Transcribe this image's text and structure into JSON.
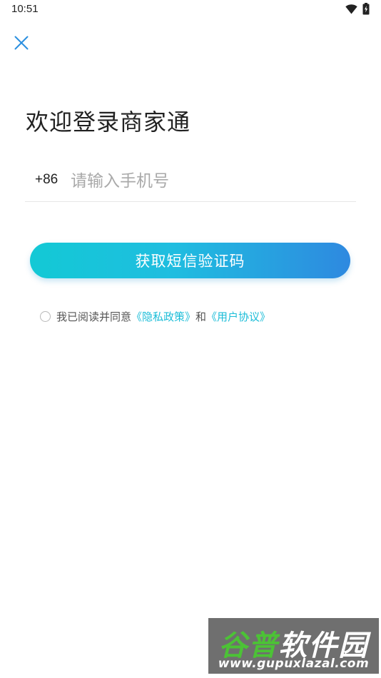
{
  "status_bar": {
    "time": "10:51",
    "wifi_icon": "wifi-icon",
    "battery_icon": "battery-charging-icon"
  },
  "header": {
    "close_icon": "close-icon"
  },
  "login": {
    "title": "欢迎登录商家通",
    "country_code": "+86",
    "phone_placeholder": "请输入手机号",
    "phone_value": "",
    "submit_label": "获取短信验证码"
  },
  "agreement": {
    "checked": false,
    "text_prefix": "我已阅读并同意",
    "privacy_link": "《隐私政策》",
    "conjunction": "和",
    "user_link": "《用户协议》"
  },
  "colors": {
    "accent": "#1cbdd8",
    "button_gradient_start": "#13c9d5",
    "button_gradient_end": "#2e89e0",
    "close_icon": "#2b8fe0"
  },
  "watermark": {
    "title_part1": "谷普",
    "title_part2": "软件园",
    "url": "www.gupuxlazal.com"
  }
}
